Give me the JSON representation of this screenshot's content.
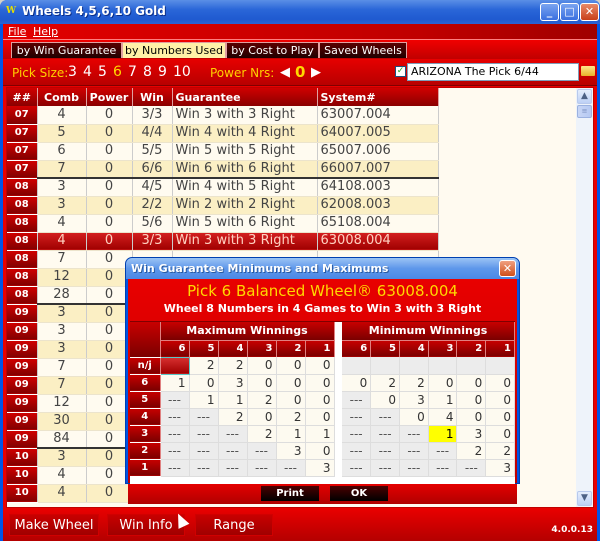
{
  "window": {
    "title": "Wheels 4,5,6,10 Gold",
    "app_icon": "W",
    "controls": {
      "minimize": "_",
      "maximize": "□",
      "close": "✕"
    }
  },
  "menu": [
    "File",
    "Help"
  ],
  "tabs": [
    {
      "label": "by Win Guarantee",
      "active": false
    },
    {
      "label": "by Numbers Used",
      "active": true
    },
    {
      "label": "by Cost to Play",
      "active": false
    },
    {
      "label": "Saved Wheels",
      "active": false
    }
  ],
  "picker": {
    "pick_size_label": "Pick Size:",
    "pick_sizes": [
      "3",
      "4",
      "5",
      "6",
      "7",
      "8",
      "9",
      "10"
    ],
    "selected_pick_size": "6",
    "power_label": "Power Nrs:",
    "power_value": "0",
    "lottery_checked": true,
    "lottery": "ARIZONA The Pick 6/44"
  },
  "table": {
    "columns": [
      "##",
      "Comb",
      "Power",
      "Win",
      "Guarantee",
      "System#"
    ],
    "rows": [
      {
        "nn": "07",
        "comb": "4",
        "power": "0",
        "win": "3/3",
        "guarantee": "Win 3 with 3 Right",
        "system": "63007.004"
      },
      {
        "nn": "07",
        "comb": "5",
        "power": "0",
        "win": "4/4",
        "guarantee": "Win 4 with 4 Right",
        "system": "64007.005"
      },
      {
        "nn": "07",
        "comb": "6",
        "power": "0",
        "win": "5/5",
        "guarantee": "Win 5 with 5 Right",
        "system": "65007.006"
      },
      {
        "nn": "07",
        "comb": "7",
        "power": "0",
        "win": "6/6",
        "guarantee": "Win 6 with 6 Right",
        "system": "66007.007"
      },
      {
        "nn": "08",
        "comb": "3",
        "power": "0",
        "win": "4/5",
        "guarantee": "Win 4 with 5 Right",
        "system": "64108.003"
      },
      {
        "nn": "08",
        "comb": "3",
        "power": "0",
        "win": "2/2",
        "guarantee": "Win 2 with 2 Right",
        "system": "62008.003"
      },
      {
        "nn": "08",
        "comb": "4",
        "power": "0",
        "win": "5/6",
        "guarantee": "Win 5 with 6 Right",
        "system": "65108.004"
      },
      {
        "nn": "08",
        "comb": "4",
        "power": "0",
        "win": "3/3",
        "guarantee": "Win 3 with 3 Right",
        "system": "63008.004",
        "selected": true
      },
      {
        "nn": "08",
        "comb": "7",
        "power": "0",
        "win": "",
        "guarantee": "",
        "system": ""
      },
      {
        "nn": "08",
        "comb": "12",
        "power": "0",
        "win": "",
        "guarantee": "",
        "system": ""
      },
      {
        "nn": "08",
        "comb": "28",
        "power": "0",
        "win": "",
        "guarantee": "",
        "system": ""
      },
      {
        "nn": "09",
        "comb": "3",
        "power": "0",
        "win": "",
        "guarantee": "",
        "system": ""
      },
      {
        "nn": "09",
        "comb": "3",
        "power": "0",
        "win": "",
        "guarantee": "",
        "system": ""
      },
      {
        "nn": "09",
        "comb": "3",
        "power": "0",
        "win": "",
        "guarantee": "",
        "system": ""
      },
      {
        "nn": "09",
        "comb": "7",
        "power": "0",
        "win": "",
        "guarantee": "",
        "system": ""
      },
      {
        "nn": "09",
        "comb": "7",
        "power": "0",
        "win": "",
        "guarantee": "",
        "system": ""
      },
      {
        "nn": "09",
        "comb": "12",
        "power": "0",
        "win": "",
        "guarantee": "",
        "system": ""
      },
      {
        "nn": "09",
        "comb": "30",
        "power": "0",
        "win": "",
        "guarantee": "",
        "system": ""
      },
      {
        "nn": "09",
        "comb": "84",
        "power": "0",
        "win": "",
        "guarantee": "",
        "system": ""
      },
      {
        "nn": "10",
        "comb": "3",
        "power": "0",
        "win": "",
        "guarantee": "",
        "system": ""
      },
      {
        "nn": "10",
        "comb": "4",
        "power": "0",
        "win": "",
        "guarantee": "",
        "system": ""
      },
      {
        "nn": "10",
        "comb": "4",
        "power": "0",
        "win": "",
        "guarantee": "",
        "system": ""
      }
    ]
  },
  "bottom": {
    "buttons": [
      "Make Wheel",
      "Win Info",
      "Range"
    ],
    "version": "4.0.0.13"
  },
  "dialog": {
    "title": "Win Guarantee Minimums and Maximums",
    "heading": "Pick 6 Balanced Wheel® 63008.004",
    "subheading": "Wheel 8 Numbers in 4 Games to Win 3 with 3 Right",
    "max_label": "Maximum Winnings",
    "min_label": "Minimum Winnings",
    "col_headers": [
      "6",
      "5",
      "4",
      "3",
      "2",
      "1"
    ],
    "row_headers": [
      "n/j",
      "6",
      "5",
      "4",
      "3",
      "2",
      "1"
    ],
    "max_rows": [
      [
        "",
        "2",
        "2",
        "0",
        "0",
        "0"
      ],
      [
        "1",
        "0",
        "3",
        "0",
        "0",
        "0"
      ],
      [
        "---",
        "1",
        "1",
        "2",
        "0",
        "0"
      ],
      [
        "---",
        "---",
        "2",
        "0",
        "2",
        "0"
      ],
      [
        "---",
        "---",
        "---",
        "2",
        "1",
        "1"
      ],
      [
        "---",
        "---",
        "---",
        "---",
        "3",
        "0"
      ],
      [
        "---",
        "---",
        "---",
        "---",
        "---",
        "3"
      ]
    ],
    "min_rows": [
      [
        "",
        "",
        "",
        "",
        "",
        ""
      ],
      [
        "0",
        "2",
        "2",
        "0",
        "0",
        "0"
      ],
      [
        "---",
        "0",
        "3",
        "1",
        "0",
        "0"
      ],
      [
        "---",
        "---",
        "0",
        "4",
        "0",
        "0"
      ],
      [
        "---",
        "---",
        "---",
        "1",
        "3",
        "0"
      ],
      [
        "---",
        "---",
        "---",
        "---",
        "2",
        "2"
      ],
      [
        "---",
        "---",
        "---",
        "---",
        "---",
        "3"
      ]
    ],
    "highlight": {
      "table": "min",
      "row": 4,
      "col": 3
    },
    "buttons": {
      "print": "Print",
      "ok": "OK"
    }
  }
}
